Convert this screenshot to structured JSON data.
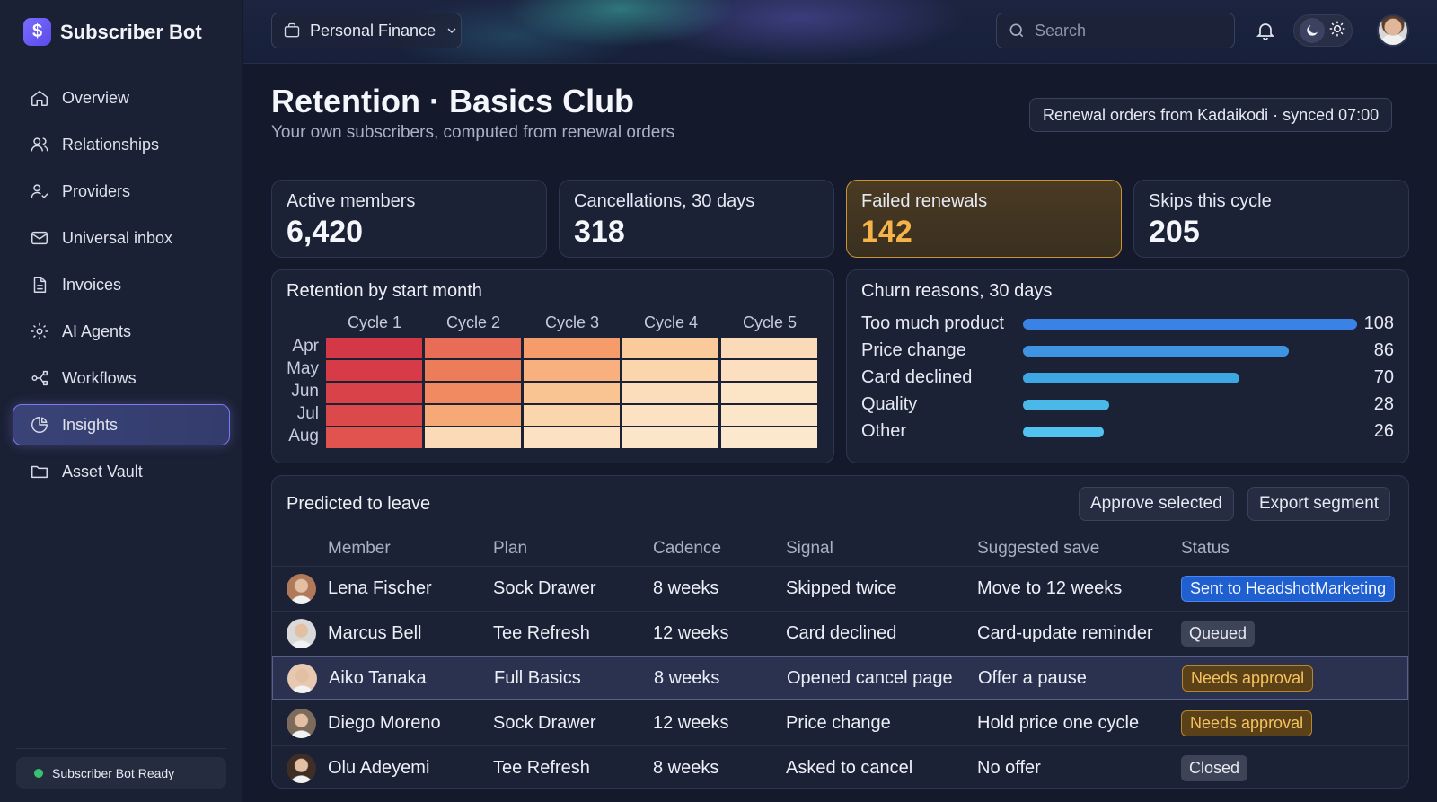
{
  "app": {
    "name": "Subscriber Bot"
  },
  "sidebar": {
    "items": [
      {
        "label": "Overview",
        "icon": "home-icon"
      },
      {
        "label": "Relationships",
        "icon": "users-icon"
      },
      {
        "label": "Providers",
        "icon": "user-check-icon"
      },
      {
        "label": "Universal inbox",
        "icon": "mail-icon"
      },
      {
        "label": "Invoices",
        "icon": "file-icon"
      },
      {
        "label": "AI Agents",
        "icon": "gear-icon"
      },
      {
        "label": "Workflows",
        "icon": "workflow-icon"
      },
      {
        "label": "Insights",
        "icon": "pie-chart-icon",
        "active": true
      },
      {
        "label": "Asset Vault",
        "icon": "folder-icon"
      }
    ],
    "status": "Subscriber Bot Ready"
  },
  "topbar": {
    "workspace": "Personal Finance",
    "search_placeholder": "Search"
  },
  "header": {
    "title": "Retention · Basics Club",
    "subtitle": "Your own subscribers, computed from renewal orders",
    "sync": "Renewal orders from Kadaikodi · synced 07:00"
  },
  "stats": [
    {
      "label": "Active members",
      "value": "6,420"
    },
    {
      "label": "Cancellations, 30 days",
      "value": "318"
    },
    {
      "label": "Failed renewals",
      "value": "142",
      "highlight": true
    },
    {
      "label": "Skips this cycle",
      "value": "205"
    }
  ],
  "chart_data": [
    {
      "type": "heatmap",
      "title": "Retention by start month",
      "columns": [
        "Cycle 1",
        "Cycle 2",
        "Cycle 3",
        "Cycle 4",
        "Cycle 5"
      ],
      "rows": [
        "Apr",
        "May",
        "Jun",
        "Jul",
        "Aug"
      ],
      "values": [
        [
          1.0,
          0.72,
          0.52,
          0.28,
          0.12
        ],
        [
          0.98,
          0.66,
          0.42,
          0.18,
          0.08
        ],
        [
          0.94,
          0.6,
          0.32,
          0.1,
          0.04
        ],
        [
          0.9,
          0.46,
          0.18,
          0.06,
          0.02
        ],
        [
          0.84,
          0.12,
          0.06,
          0.02,
          0.0
        ]
      ]
    },
    {
      "type": "bar",
      "title": "Churn reasons, 30 days",
      "categories": [
        "Too much product",
        "Price change",
        "Card declined",
        "Quality",
        "Other"
      ],
      "values": [
        108,
        86,
        70,
        28,
        26
      ],
      "colors": [
        "#3b82e6",
        "#3f94e2",
        "#3fa6e4",
        "#4bb8ea",
        "#52c2ee"
      ]
    }
  ],
  "predicted": {
    "title": "Predicted to leave",
    "approve_label": "Approve selected",
    "export_label": "Export segment",
    "columns": [
      "Member",
      "Plan",
      "Cadence",
      "Signal",
      "Suggested save",
      "Status"
    ],
    "rows": [
      {
        "member": "Lena Fischer",
        "plan": "Sock Drawer",
        "cadence": "8 weeks",
        "signal": "Skipped twice",
        "save": "Move to 12 weeks",
        "status": "Sent to HeadshotMarketing",
        "status_kind": "blue"
      },
      {
        "member": "Marcus Bell",
        "plan": "Tee Refresh",
        "cadence": "12 weeks",
        "signal": "Card declined",
        "save": "Card-update reminder",
        "status": "Queued",
        "status_kind": "gray"
      },
      {
        "member": "Aiko Tanaka",
        "plan": "Full Basics",
        "cadence": "8 weeks",
        "signal": "Opened cancel page",
        "save": "Offer a pause",
        "status": "Needs approval",
        "status_kind": "amber",
        "selected": true
      },
      {
        "member": "Diego Moreno",
        "plan": "Sock Drawer",
        "cadence": "12 weeks",
        "signal": "Price change",
        "save": "Hold price one cycle",
        "status": "Needs approval",
        "status_kind": "amber"
      },
      {
        "member": "Olu Adeyemi",
        "plan": "Tee Refresh",
        "cadence": "8 weeks",
        "signal": "Asked to cancel",
        "save": "No offer",
        "status": "Closed",
        "status_kind": "gray"
      }
    ]
  }
}
